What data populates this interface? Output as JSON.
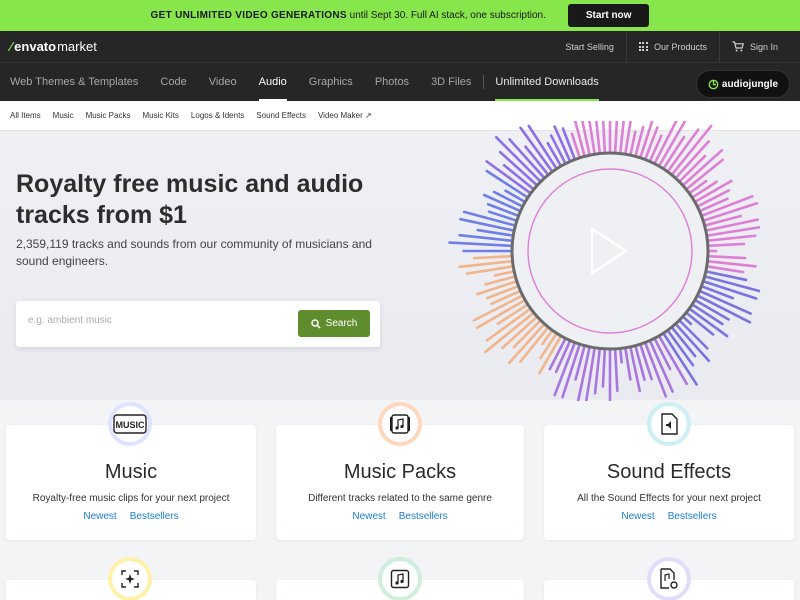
{
  "promo": {
    "strong": "GET UNLIMITED VIDEO GENERATIONS",
    "rest": "until Sept 30. Full AI stack, one subscription.",
    "button": "Start now"
  },
  "brand": {
    "name_bold": "envato",
    "name_light": "market"
  },
  "top_links": {
    "sell": "Start Selling",
    "products": "Our Products",
    "signin": "Sign In"
  },
  "main_nav": [
    "Web Themes & Templates",
    "Code",
    "Video",
    "Audio",
    "Graphics",
    "Photos",
    "3D Files"
  ],
  "main_nav_extra": "Unlimited Downloads",
  "market_badge": "audiojungle",
  "sub_nav": [
    "All Items",
    "Music",
    "Music Packs",
    "Music Kits",
    "Logos & Idents",
    "Sound Effects",
    "Video Maker"
  ],
  "hero": {
    "title": "Royalty free music and audio tracks from $1",
    "subtitle": "2,359,119 tracks and sounds from our community of musicians and sound engineers.",
    "search_placeholder": "e.g. ambient music",
    "search_button": "Search"
  },
  "cards": [
    {
      "title": "Music",
      "desc": "Royalty-free music clips for your next project",
      "link1": "Newest",
      "link2": "Bestsellers",
      "icon_text": "MUSIC"
    },
    {
      "title": "Music Packs",
      "desc": "Different tracks related to the same genre",
      "link1": "Newest",
      "link2": "Bestsellers"
    },
    {
      "title": "Sound Effects",
      "desc": "All the Sound Effects for your next project",
      "link1": "Newest",
      "link2": "Bestsellers"
    }
  ],
  "colors": {
    "accent": "#87e64b",
    "link": "#1c7ed6",
    "search_btn": "#5f8d2e"
  }
}
